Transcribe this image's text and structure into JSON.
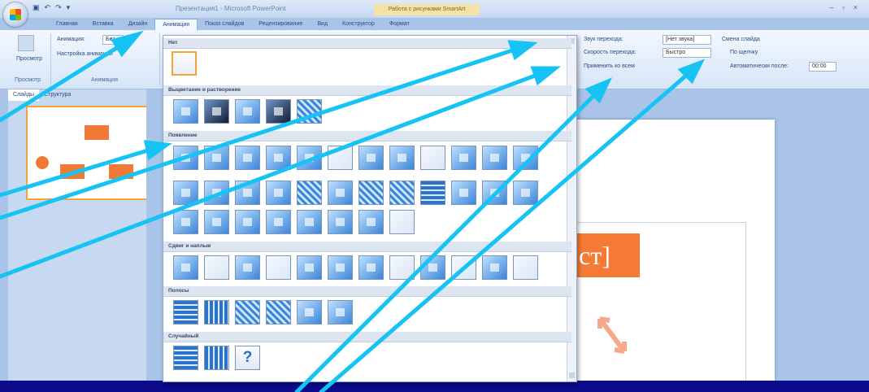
{
  "window": {
    "title": "Презентация1 - Microsoft PowerPoint",
    "context_tab": "Работа с рисунками SmartArt",
    "controls": "– ▫ ×"
  },
  "ribbon_tabs": [
    "Главная",
    "Вставка",
    "Дизайн",
    "Анимация",
    "Показ слайдов",
    "Рецензирование",
    "Вид",
    "Конструктор",
    "Формат"
  ],
  "active_tab": "Анимация",
  "ribbon": {
    "preview_label": "Просмотр",
    "animation_label": "Анимация:",
    "animation_value": "Без",
    "custom_animation": "Настройка анимации",
    "group_preview": "Просмотр",
    "group_animation": "Анимация",
    "sound_label": "Звук перехода:",
    "sound_value": "[Нет звука]",
    "speed_label": "Скорость перехода:",
    "speed_value": "Быстро",
    "apply_all": "Применить ко всем",
    "change_slide": "Смена слайда",
    "on_click": "По щелчку",
    "auto_after": "Автоматически после:",
    "auto_value": "00:00"
  },
  "pane_tabs": [
    "Слайды",
    "Структура"
  ],
  "gallery": {
    "sections": [
      {
        "title": "Нет"
      },
      {
        "title": "Выцветание и растворение"
      },
      {
        "title": "Появление"
      },
      {
        "title": "Сдвиг и наплыв"
      },
      {
        "title": "Полосы"
      },
      {
        "title": "Случайный"
      }
    ],
    "random_glyph": "?"
  },
  "slide": {
    "text": "ст]"
  },
  "colors": {
    "background": "#0b0b8c",
    "arrow": "#17c3f5",
    "accent": "#f47a35"
  }
}
